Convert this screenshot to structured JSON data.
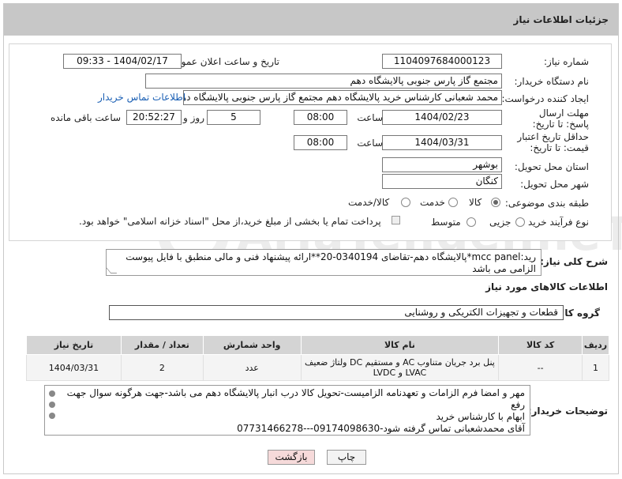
{
  "header": {
    "title": "جزئیات اطلاعات نیاز"
  },
  "fields": {
    "need_number_label": "شماره نیاز:",
    "need_number": "1104097684000123",
    "announce_label": "تاریخ و ساعت اعلان عمومی:",
    "announce_value": "1404/02/17 - 09:33",
    "buyer_label": "نام دستگاه خریدار:",
    "buyer_value": "مجتمع گاز پارس جنوبی  پالایشگاه دهم",
    "creator_label": "ایجاد کننده درخواست:",
    "creator_value": "محمد شعبانی کارشناس خرید پالایشگاه دهم  مجتمع گاز پارس جنوبی  پالایشگاه دهم",
    "contact_link": "اطلاعات تماس خریدار",
    "deadline_label": "مهلت ارسال پاسخ: تا تاریخ:",
    "deadline_date": "1404/02/23",
    "time_label": "ساعت",
    "deadline_time": "08:00",
    "days_value": "5",
    "days_label": "روز و",
    "remaining_value": "20:52:27",
    "remaining_label": "ساعت باقی مانده",
    "min_price_label": "حداقل تاریخ اعتبار قیمت: تا تاریخ:",
    "min_price_date": "1404/03/31",
    "min_price_time": "08:00",
    "province_label": "استان محل تحویل:",
    "province_value": "بوشهر",
    "city_label": "شهر محل تحویل:",
    "city_value": "کنگان",
    "category_label": "طبقه بندی موضوعی:",
    "category_options": [
      "کالا",
      "خدمت",
      "کالا/خدمت"
    ],
    "category_selected": "کالا",
    "process_label": "نوع فرآیند خرید :",
    "process_options": [
      "جزیی",
      "متوسط"
    ],
    "payment_note": "پرداخت تمام یا بخشی از مبلغ خرید،از محل \"اسناد خزانه اسلامی\" خواهد بود."
  },
  "description": {
    "label": "شرح کلی نیاز:",
    "text": "رید:mcc panel*پالایشگاه دهم-تقاضای 0340194-20**ارائه پیشنهاد فنی و مالی منطبق با فایل پیوست الزامی می باشد"
  },
  "goods": {
    "section_title": "اطلاعات کالاهای مورد نیاز",
    "group_label": "گروه کالا:",
    "group_value": "قطعات و تجهیزات الکتریکی و روشنایی",
    "columns": [
      "ردیف",
      "کد کالا",
      "نام کالا",
      "واحد شمارش",
      "تعداد / مقدار",
      "تاریخ نیاز"
    ],
    "rows": [
      {
        "row": "1",
        "code": "--",
        "name": "پنل برد جریان متناوب AC و مستقیم DC ولتاژ ضعیف LVAC و LVDC",
        "unit": "عدد",
        "qty": "2",
        "date": "1404/03/31"
      }
    ]
  },
  "notes": {
    "label": "توضیحات خریدار:",
    "lines": [
      "مهر و امضا فرم الزامات و تعهدنامه الزامیست-تحویل کالا درب انبار پالایشگاه دهم می باشد-جهت هرگونه سوال جهت رفع",
      "ابهام با کارشناس خرید",
      "آقای محمدشعبانی تماس گرفته شود-09174098630---07731466278"
    ]
  },
  "buttons": {
    "print": "چاپ",
    "back": "بازگشت"
  },
  "watermark": "AriaTender.neT"
}
